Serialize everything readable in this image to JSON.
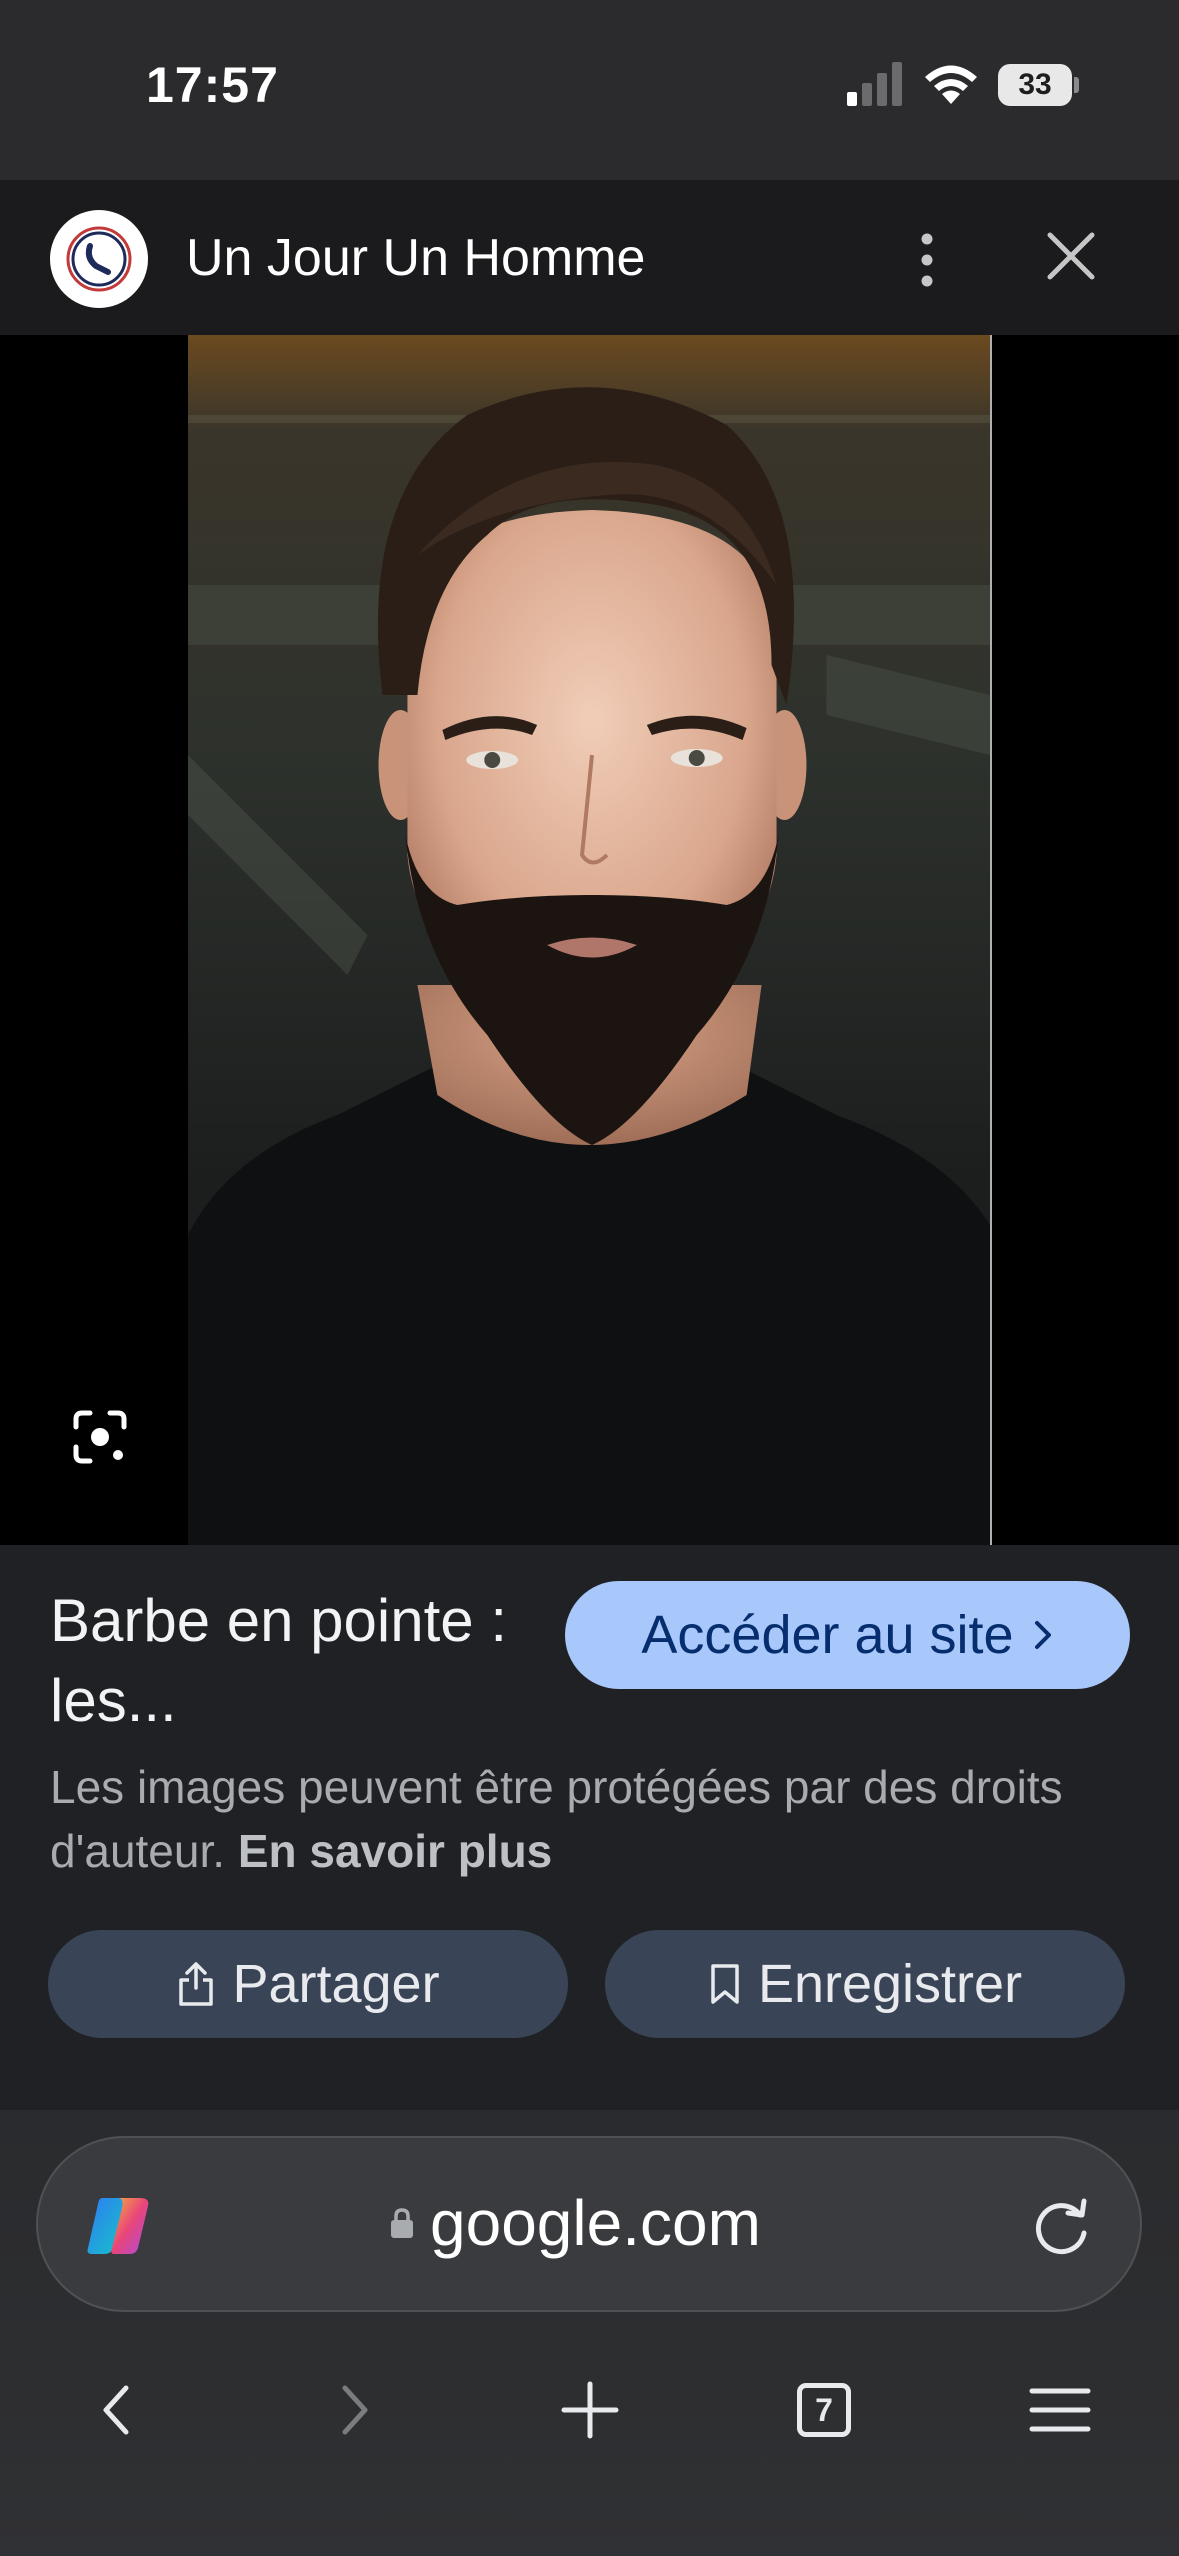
{
  "status_bar": {
    "time": "17:57",
    "battery": "33",
    "icons": [
      "signal-icon",
      "wifi-icon",
      "battery-icon"
    ]
  },
  "header": {
    "site_name": "Un Jour Un Homme",
    "icons": [
      "site-logo-icon",
      "more-vert-icon",
      "close-icon"
    ]
  },
  "viewer": {
    "photo_icon": "lens-icon"
  },
  "info": {
    "title": "Barbe en pointe : les...",
    "visit_label": "Accéder au site",
    "copyright_text": "Les images peuvent être protégées par des droits d'auteur.",
    "learn_more": "En savoir plus",
    "share_label": "Partager",
    "save_label": "Enregistrer"
  },
  "browser": {
    "url": "google.com",
    "tab_count": "7",
    "icons": [
      "copilot-icon",
      "lock-icon",
      "reload-icon",
      "back-icon",
      "forward-icon",
      "new-tab-icon",
      "tabs-icon",
      "menu-icon"
    ]
  },
  "colors": {
    "accent_button": "#a8c7fa",
    "action_button": "#394457",
    "panel_bg": "#202124"
  }
}
